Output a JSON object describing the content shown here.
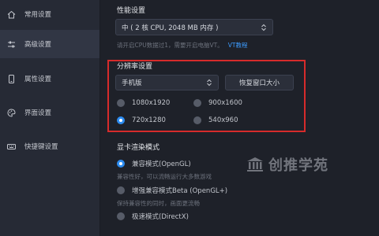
{
  "sidebar": {
    "items": [
      {
        "label": "常用设置",
        "icon": "home-icon"
      },
      {
        "label": "高级设置",
        "icon": "sliders-icon"
      },
      {
        "label": "属性设置",
        "icon": "phone-icon"
      },
      {
        "label": "界面设置",
        "icon": "palette-icon"
      },
      {
        "label": "快捷键设置",
        "icon": "keyboard-icon"
      }
    ],
    "active_index": 1
  },
  "performance": {
    "title": "性能设置",
    "select_value": "中 ( 2 核 CPU, 2048 MB 内存 )",
    "hint": "请开启CPU数据过1，需要开启电脑VT。",
    "link": "VT教程"
  },
  "resolution": {
    "title": "分辨率设置",
    "select_value": "手机版",
    "restore_button": "恢复窗口大小",
    "options": [
      {
        "label": "1080x1920",
        "selected": false
      },
      {
        "label": "900x1600",
        "selected": false
      },
      {
        "label": "720x1280",
        "selected": true
      },
      {
        "label": "540x960",
        "selected": false
      }
    ]
  },
  "render": {
    "title": "显卡渲染模式",
    "options": [
      {
        "label": "兼容模式(OpenGL)",
        "selected": true,
        "desc": "兼容性好，可以流畅运行大多数游戏"
      },
      {
        "label": "增强兼容模式Beta (OpenGL+)",
        "selected": false,
        "desc": "保持兼容性的同时，画面更流畅"
      },
      {
        "label": "极速模式(DirectX)",
        "selected": false,
        "desc": ""
      }
    ]
  },
  "watermark": {
    "text": "创推学苑"
  },
  "colors": {
    "accent": "#2d8cf0",
    "highlight_border": "#d62b2b",
    "link": "#3d9cff"
  }
}
